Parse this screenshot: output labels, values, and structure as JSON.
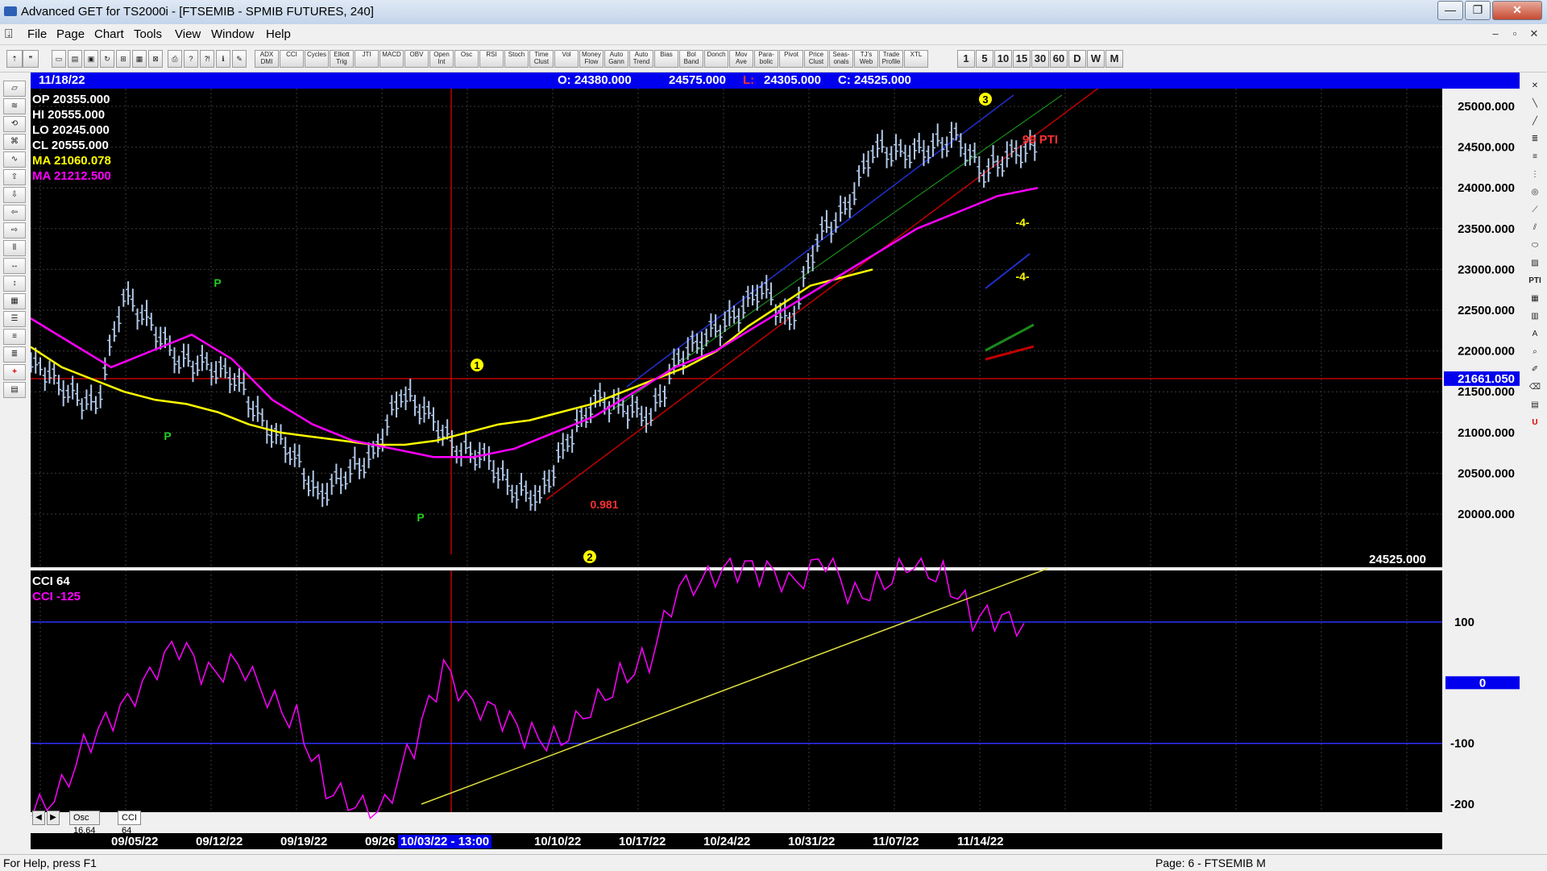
{
  "window": {
    "title": "Advanced GET for TS2000i - [FTSEMIB - SPMIB FUTURES, 240]",
    "minimize": "—",
    "restore": "❐",
    "close": "✕"
  },
  "menu": {
    "items": [
      "File",
      "Page",
      "Chart",
      "Tools",
      "View",
      "Window",
      "Help"
    ],
    "mdi": [
      "–",
      "▫",
      "✕"
    ]
  },
  "toolbar": {
    "study_buttons": [
      "ADX DMI",
      "CCI",
      "Cycles",
      "Elliott Trig",
      "JTI",
      "MACD",
      "OBV",
      "Open Int",
      "Osc",
      "RSI",
      "Stoch",
      "Time Clust",
      "Vol",
      "Money Flow",
      "Auto Gann",
      "Auto Trend",
      "Bias",
      "Bol Band",
      "Donch",
      "Mov Ave",
      "Para-bolic",
      "Pivot",
      "Price Clust",
      "Seas-onals",
      "TJ's Web",
      "Trade Profile",
      "XTL"
    ],
    "periods": [
      "1",
      "5",
      "10",
      "15",
      "30",
      "60",
      "D",
      "W",
      "M"
    ]
  },
  "infobar": {
    "date": "11/18/22",
    "open": "O: 24380.000",
    "high": "24575.000",
    "low_label": "L:",
    "low": "24305.000",
    "close": "C: 24525.000"
  },
  "readout": {
    "op": "OP  20355.000",
    "hi": "HI   20555.000",
    "lo": "LO  20245.000",
    "cl": "CL  20555.000",
    "ma1": "MA  21060.078",
    "ma2": "MA  21212.500"
  },
  "price_axis": {
    "labels": [
      "25000.000",
      "24500.000",
      "24000.000",
      "23500.000",
      "23000.000",
      "22500.000",
      "22000.000",
      "21500.000",
      "21000.000",
      "20500.000",
      "20000.000"
    ],
    "cursor_value": "21661.050",
    "last_price": "24525.000"
  },
  "cci_panel": {
    "title": "CCI 64",
    "value": "CCI  -125",
    "axis": [
      "100",
      "0",
      "-100",
      "-200"
    ]
  },
  "elliott_labels": {
    "wave1": "1",
    "wave2": "2",
    "wave3": "3",
    "p": "P",
    "pti": "99 PTI",
    "ratio": "0.981",
    "minus4": "-4-"
  },
  "dates": [
    "09/05/22",
    "09/12/22",
    "09/19/22",
    "09/26",
    "10/03/22 - 13:00",
    "10/10/22",
    "10/17/22",
    "10/24/22",
    "10/31/22",
    "11/07/22",
    "11/14/22"
  ],
  "tabs": [
    "Osc 16,64",
    "CCI 64"
  ],
  "status": {
    "help": "For Help, press F1",
    "page": "Page: 6 - FTSEMIB M"
  },
  "chart_data": {
    "type": "line",
    "price_series": {
      "name": "FTSEMIB",
      "x": [
        "09/01",
        "09/05",
        "09/08",
        "09/12",
        "09/14",
        "09/16",
        "09/19",
        "09/21",
        "09/23",
        "09/26",
        "09/28",
        "09/29",
        "09/30",
        "10/03",
        "10/05",
        "10/07",
        "10/10",
        "10/12",
        "10/13",
        "10/14",
        "10/17",
        "10/19",
        "10/21",
        "10/24",
        "10/26",
        "10/27",
        "10/28",
        "10/31",
        "11/02",
        "11/04",
        "11/07",
        "11/09",
        "11/10",
        "11/11",
        "11/14",
        "11/16",
        "11/18"
      ],
      "y": [
        21800,
        21500,
        21300,
        22700,
        22300,
        21900,
        21800,
        21700,
        21100,
        20800,
        20200,
        20500,
        20700,
        21500,
        21200,
        20800,
        20700,
        20300,
        20200,
        20900,
        21400,
        21300,
        21200,
        21900,
        22200,
        22400,
        22800,
        22300,
        23400,
        23700,
        24500,
        24400,
        24500,
        24600,
        24200,
        24400,
        24525
      ]
    },
    "ma_yellow": [
      22050,
      21800,
      21650,
      21500,
      21400,
      21350,
      21250,
      21100,
      21000,
      20950,
      20900,
      20850,
      20850,
      20900,
      21000,
      21100,
      21150,
      21250,
      21350,
      21500,
      21650,
      21800,
      22000,
      22300,
      22550,
      22800,
      22900,
      23000
    ],
    "ma_magenta": [
      22400,
      22100,
      21800,
      22000,
      22200,
      21900,
      21400,
      21100,
      20900,
      20800,
      20700,
      20700,
      20800,
      21000,
      21200,
      21500,
      21800,
      22000,
      22300,
      22600,
      22900,
      23200,
      23500,
      23700,
      23900,
      24000
    ],
    "cci": [
      -220,
      -170,
      -90,
      -50,
      20,
      60,
      10,
      40,
      -30,
      -60,
      -170,
      -210,
      -200,
      -100,
      20,
      -30,
      -60,
      -90,
      -90,
      -50,
      10,
      40,
      150,
      180,
      190,
      180,
      170,
      200,
      140,
      170,
      190,
      180,
      110,
      100
    ],
    "price_ylim": [
      19800,
      25300
    ],
    "cci_ylim": [
      -250,
      210
    ],
    "cci_levels": [
      100,
      0,
      -100,
      -200
    ]
  }
}
